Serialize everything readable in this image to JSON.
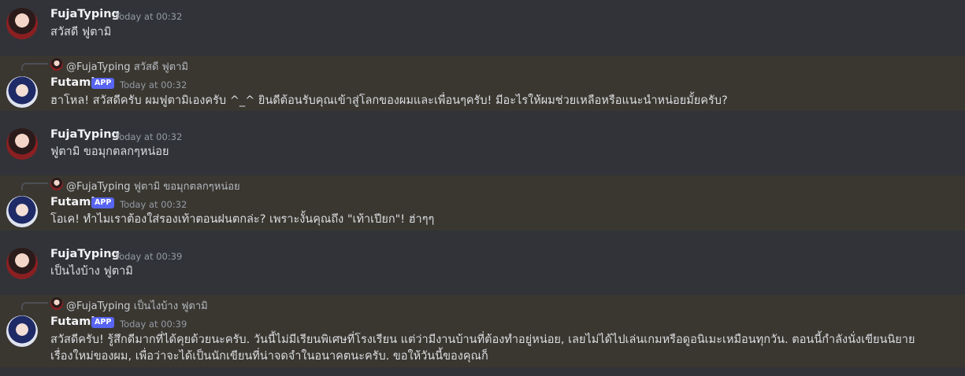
{
  "messages": [
    {
      "author": "FujaTyping",
      "timestamp": "Today at 00:32",
      "text": "สวัสดี ฟูตามิ"
    },
    {
      "reply_to": "@FujaTyping",
      "reply_text": "สวัสดี ฟูตามิ",
      "author": "Futami",
      "badge": "APP",
      "timestamp": "Today at 00:32",
      "text": "ฮาโหล! สวัสดีครับ ผมฟูตามิเองครับ ^_^ ยินดีต้อนรับคุณเข้าสู่โลกของผมและเพื่อนๆครับ! มีอะไรให้ผมช่วยเหลือหรือแนะนำหน่อยมั้ยครับ?"
    },
    {
      "author": "FujaTyping",
      "timestamp": "Today at 00:32",
      "text": "ฟูตามิ ขอมุกตลกๆหน่อย"
    },
    {
      "reply_to": "@FujaTyping",
      "reply_text": "ฟูตามิ ขอมุกตลกๆหน่อย",
      "author": "Futami",
      "badge": "APP",
      "timestamp": "Today at 00:32",
      "text": "โอเค! ทำไมเราต้องใส่รองเท้าตอนฝนตกล่ะ? เพราะงั้นคุณถึง \"เท้าเปียก\"! ฮ่าๆๆ"
    },
    {
      "author": "FujaTyping",
      "timestamp": "Today at 00:39",
      "text": "เป็นไงบ้าง ฟูตามิ"
    },
    {
      "reply_to": "@FujaTyping",
      "reply_text": "เป็นไงบ้าง ฟูตามิ",
      "author": "Futami",
      "badge": "APP",
      "timestamp": "Today at 00:39",
      "text_line1": "สวัสดีครับ! รู้สึกดีมากที่ได้คุยด้วยนะครับ. วันนี้ไม่มีเรียนพิเศษที่โรงเรียน แต่ว่ามีงานบ้านที่ต้องทำอยู่หน่อย, เลยไม่ได้ไปเล่นเกมหรือดูอนิเมะเหมือนทุกวัน. ตอนนี้กำลังนั่งเขียนนิยาย",
      "text_line2": "เรื่องใหม่ของผม, เพื่อว่าจะได้เป็นนักเขียนที่น่าจดจำในอนาคตนะครับ. ขอให้วันนี้ของคุณก็"
    }
  ]
}
